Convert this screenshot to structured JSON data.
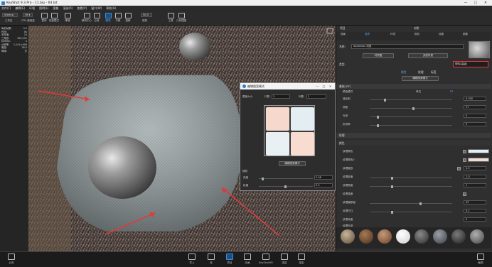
{
  "window": {
    "title": "KeyShot 9.3 Pro  -  11.bip  -  64 bit",
    "controls": [
      "—",
      "□",
      "✕"
    ]
  },
  "menu": [
    "文件(F)",
    "编辑(E)",
    "环境",
    "照明(L)",
    "图像",
    "渲染(R)",
    "查看(V)",
    "窗口(W)",
    "帮助(H)"
  ],
  "toolbar": {
    "workspace_select": "Startup",
    "workspace_label": "工作区",
    "cpu_select": "38 ▾",
    "cpu_label": "CPU 使用量",
    "pause_label": "暂停",
    "perf_label": "性能模式",
    "denoise_label": "降噪",
    "mode_label": "移到中心",
    "cloud_label": "云库",
    "tumble_label": "翻滚",
    "pan_label": "平移",
    "dolly_label": "推移",
    "fov_value": "50.0",
    "fov_label": "视角",
    "tools_label": "工具",
    "geom_label": "几何视图"
  },
  "stats": [
    {
      "k": "每秒帧数:",
      "v": "4.9"
    },
    {
      "k": "时间:",
      "v": "8s"
    },
    {
      "k": "采样值:",
      "v": "24"
    },
    {
      "k": "三角形:",
      "v": "189,032"
    },
    {
      "k": "NURBS:",
      "v": "0"
    },
    {
      "k": "分辨率:",
      "v": "1,141×648"
    },
    {
      "k": "焦距:",
      "v": "36.0"
    },
    {
      "k": "降噪:",
      "v": "关"
    }
  ],
  "dialog": {
    "title": "编辑图案模式",
    "controls": [
      "—",
      "□",
      "✕"
    ],
    "grid_size_label": "图案大小",
    "row_label": "行数",
    "row_value": "2",
    "col_label": "列数",
    "col_value": "2",
    "edit_button": "编辑图案模式",
    "noise_section": "随机",
    "hue_label": "亮度",
    "hue_value": "0.08",
    "weight_label": "权重",
    "weight_value": "0.5",
    "tile_colors": [
      "#f6d9cc",
      "#e4eef2",
      "#e8f0f4",
      "#f7dccf"
    ]
  },
  "rpanel": {
    "tab_project": "项目",
    "tab_material": "材质",
    "icon_tabs": [
      "场景",
      "材质",
      "环境",
      "相机",
      "设置",
      "图像"
    ],
    "name_label": "名称:",
    "name_value": "Seamless 材质",
    "btn_material_graph": "材质图",
    "btn_multi_material": "多层材质",
    "type_label": "类型:",
    "type_value": "塑料(高级)",
    "subtab_properties": "属性",
    "subtab_textures": "纹理",
    "subtab_labels": "标签",
    "edit_graph_button": "编辑图案模式",
    "section_basic": "基础 (RT)",
    "mode_label": "颜色模式",
    "mode_opt1": "单位",
    "mode_opt2": "RT",
    "rows": [
      {
        "label": "漫反射",
        "value": "0.000"
      },
      {
        "label": "镜面",
        "value": "37"
      },
      {
        "label": "光泽",
        "value": "0"
      },
      {
        "label": "折射率",
        "value": "0"
      }
    ],
    "section_pattern": "纹理",
    "section_sub": "颜色",
    "pattern_rows": [
      {
        "label": "纹理颜色",
        "value": ""
      },
      {
        "label": "纹理颜色2",
        "value": ""
      },
      {
        "label": "纹理缩放",
        "value": "0.5"
      },
      {
        "label": "纹理密度",
        "value": "1.0"
      },
      {
        "label": "纹理角度",
        "value": "1"
      },
      {
        "label": "纹理强度",
        "value": ""
      },
      {
        "label": "纹理偏移量",
        "value": "45"
      },
      {
        "label": "纹理凹凸",
        "value": "0.1"
      },
      {
        "label": "纹理深度",
        "value": "0"
      },
      {
        "label": "纹理光泽",
        "value": ""
      }
    ]
  },
  "bottom": {
    "left_label": "云库",
    "buttons": [
      "导入",
      "库",
      "项目",
      "动画",
      "KeyShotXR",
      "渲染",
      "渲染"
    ],
    "right_label": "截图"
  }
}
